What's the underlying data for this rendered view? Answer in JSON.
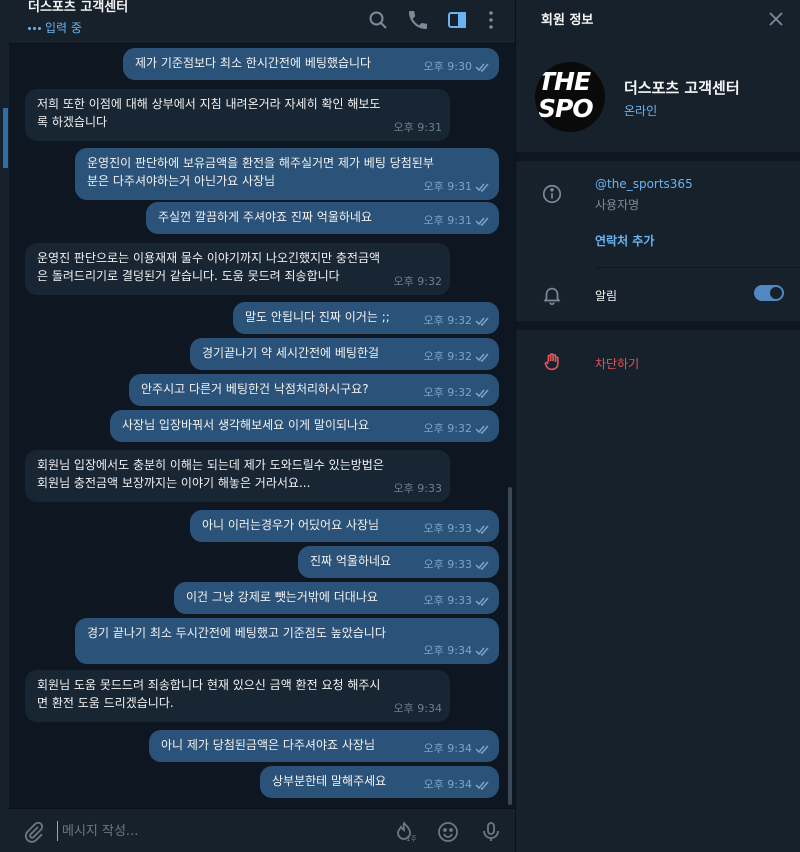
{
  "chat": {
    "title": "더스포츠 고객센터",
    "status": "입력 중",
    "composer_placeholder": "메시지 작성...",
    "messages": [
      {
        "dir": "out",
        "text": "제가 기준점보다 최소 한시간전에 베팅했습니다",
        "time": "오후 9:30"
      },
      {
        "dir": "in",
        "text": "저희 또한 이점에 대해 상부에서 지침 내려온거라 자세히 확인 해보도록 하겠습니다",
        "time": "오후 9:31"
      },
      {
        "dir": "out",
        "text": "운영진이 판단하에 보유금액을 환전을 해주실거면 제가 베팅 당첨된부분은 다주셔야하는거 아닌가요 사장님",
        "time": "오후 9:31"
      },
      {
        "dir": "out",
        "text": "주실껀 깔끔하게 주셔야죠 진짜 억울하네요",
        "time": "오후 9:31"
      },
      {
        "dir": "in",
        "text": "운영진 판단으로는 이용재재 물수 이야기까지 나오긴했지만 충전금액은 돌려드리기로 결덩된거 같습니다. 도움 못드려 죄송합니다",
        "time": "오후 9:32"
      },
      {
        "dir": "out",
        "text": "말도 안됩니다 진짜 이거는 ;;",
        "time": "오후 9:32"
      },
      {
        "dir": "out",
        "text": "경기끝나기 약 세시간전에 베팅한걸",
        "time": "오후 9:32"
      },
      {
        "dir": "out",
        "text": "안주시고 다른거 베팅한건 낙점처리하시구요?",
        "time": "오후 9:32"
      },
      {
        "dir": "out",
        "text": "사장님 입장바꿔서 생각해보세요 이게 말이되나요",
        "time": "오후 9:32"
      },
      {
        "dir": "in",
        "text": "회원님 입장에서도 충분히 이해는 되는데 제가 도와드릴수 있는방법은 회원님 충전금액 보장까지는 이야기 해놓은 거라서요...",
        "time": "오후 9:33"
      },
      {
        "dir": "out",
        "text": "아니 이러는경우가 어딨어요 사장님",
        "time": "오후 9:33"
      },
      {
        "dir": "out",
        "text": "진짜 억울하네요",
        "time": "오후 9:33"
      },
      {
        "dir": "out",
        "text": "이건 그냥 강제로 뺏는거밖에 더대나요",
        "time": "오후 9:33"
      },
      {
        "dir": "out",
        "text": "경기 끝나기 최소 두시간전에 베팅했고 기준점도 높았습니다",
        "time": "오후 9:34"
      },
      {
        "dir": "in",
        "text": "회원님 도움 못드드려 죄송합니다 현재 있으신 금액 환전 요청 해주시면 환전 도움 드리겠습니다.",
        "time": "오후 9:34"
      },
      {
        "dir": "out",
        "text": "아니 제가 당첨된금액은 다주셔야죠 사장님",
        "time": "오후 9:34"
      },
      {
        "dir": "out",
        "text": "상부분한테 말해주세요",
        "time": "오후 9:34"
      }
    ]
  },
  "profile": {
    "title": "회원 정보",
    "name": "더스포츠 고객센터",
    "status": "온라인",
    "avatar_text": "THE SPO",
    "username": "@the_sports365",
    "username_label": "사용자명",
    "add_contact": "연락처 추가",
    "notifications_label": "알림",
    "notifications_on": true,
    "block": "차단하기"
  },
  "colors": {
    "outgoing_bubble": "#2b5278",
    "incoming_bubble": "#182533",
    "accent": "#6ab3f3",
    "danger": "#e0555c"
  }
}
